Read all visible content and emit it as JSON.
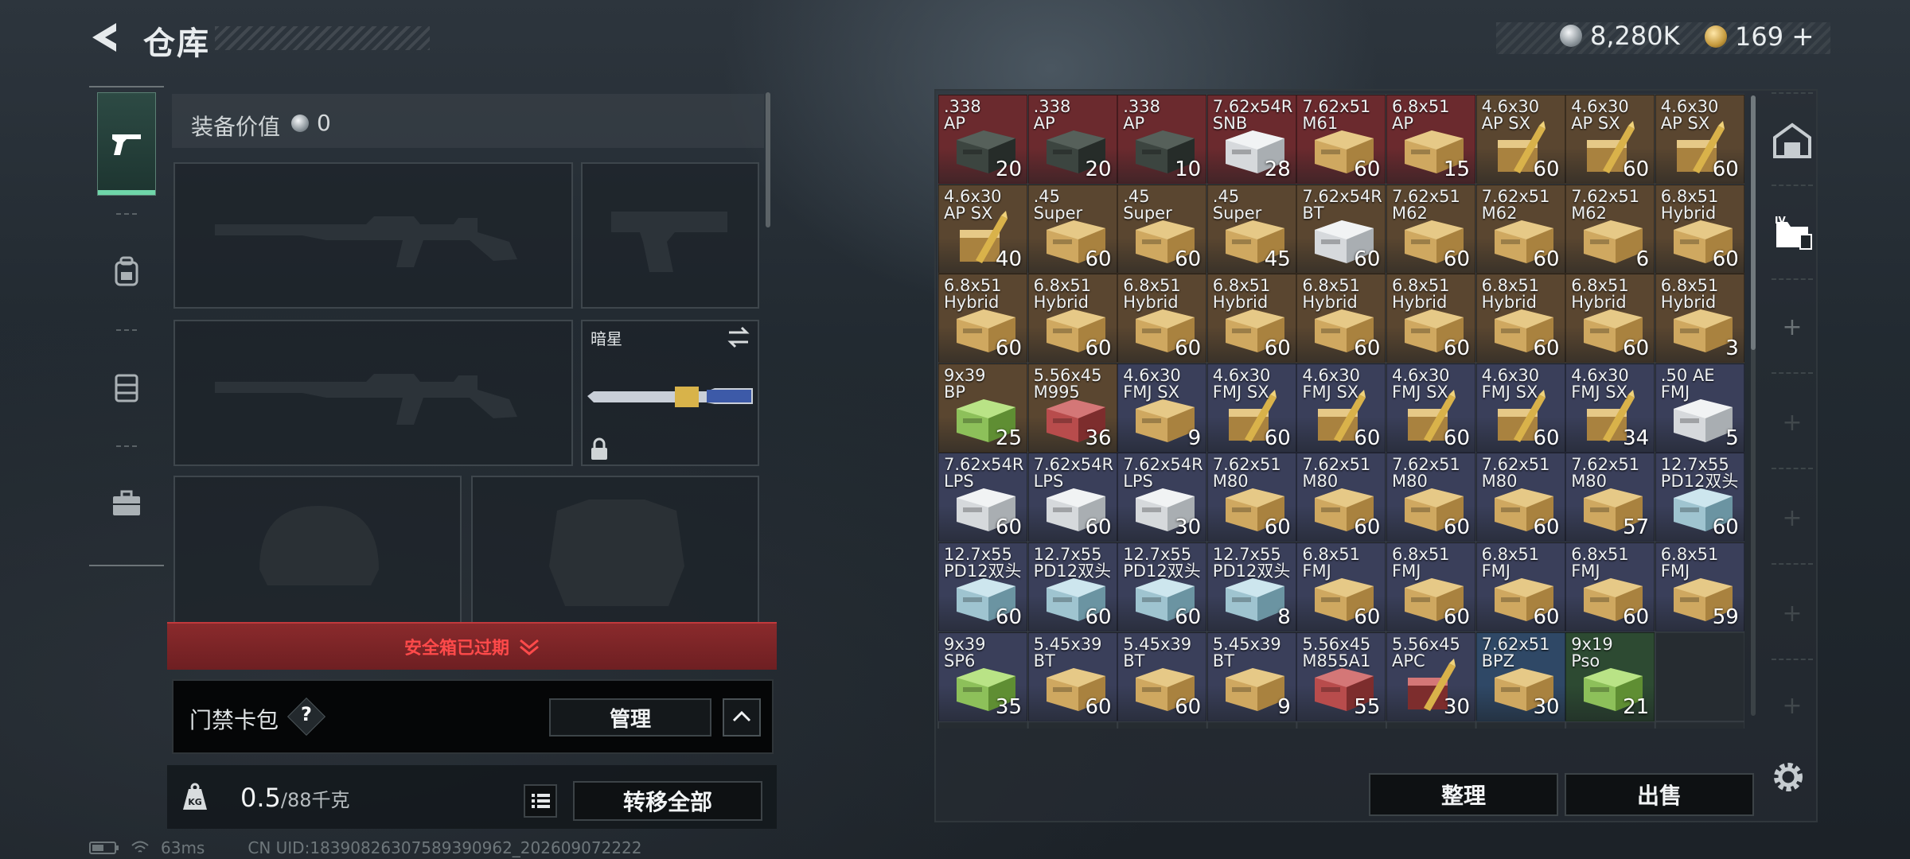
{
  "header": {
    "title": "仓库"
  },
  "currency": {
    "silver": "8,280K",
    "gold": "169",
    "gold_plus": "+"
  },
  "equipment": {
    "value_label": "装备价值",
    "value": "0",
    "melee_name": "暗星",
    "safebox_status": "安全箱已过期",
    "keycard_label": "门禁卡包",
    "help": "?",
    "manage_label": "管理",
    "weight_value": "0.5",
    "weight_capacity": "/88千克",
    "transfer_all_label": "转移全部"
  },
  "inventory": {
    "cells": [
      {
        "name": ".338\nAP",
        "count": "20",
        "bg": "#6b2a2e",
        "box": "ammo-can"
      },
      {
        "name": ".338\nAP",
        "count": "20",
        "bg": "#6b2a2e",
        "box": "ammo-can"
      },
      {
        "name": ".338\nAP",
        "count": "10",
        "bg": "#6b2a2e",
        "box": "ammo-can"
      },
      {
        "name": "7.62x54R\nSNB",
        "count": "28",
        "bg": "#6b2a2e",
        "box": "white"
      },
      {
        "name": "7.62x51\nM61",
        "count": "60",
        "bg": "#6b2a2e",
        "box": "tan"
      },
      {
        "name": "6.8x51\nAP",
        "count": "15",
        "bg": "#6b2a2e",
        "box": "tan"
      },
      {
        "name": "4.6x30\nAP SX",
        "count": "60",
        "bg": "#5a4630",
        "box": "bullet"
      },
      {
        "name": "4.6x30\nAP SX",
        "count": "60",
        "bg": "#5a4630",
        "box": "bullet"
      },
      {
        "name": "4.6x30\nAP SX",
        "count": "60",
        "bg": "#5a4630",
        "box": "bullet"
      },
      {
        "name": "4.6x30\nAP SX",
        "count": "40",
        "bg": "#5a4630",
        "box": "bullet"
      },
      {
        "name": ".45\nSuper",
        "count": "60",
        "bg": "#5a4630",
        "box": "tan"
      },
      {
        "name": ".45\nSuper",
        "count": "60",
        "bg": "#5a4630",
        "box": "tan"
      },
      {
        "name": ".45\nSuper",
        "count": "45",
        "bg": "#5a4630",
        "box": "tan"
      },
      {
        "name": "7.62x54R\nBT",
        "count": "60",
        "bg": "#5a4630",
        "box": "white"
      },
      {
        "name": "7.62x51\nM62",
        "count": "60",
        "bg": "#5a4630",
        "box": "tan"
      },
      {
        "name": "7.62x51\nM62",
        "count": "60",
        "bg": "#5a4630",
        "box": "tan"
      },
      {
        "name": "7.62x51\nM62",
        "count": "6",
        "bg": "#5a4630",
        "box": "tan"
      },
      {
        "name": "6.8x51\nHybrid",
        "count": "60",
        "bg": "#5a4630",
        "box": "tan"
      },
      {
        "name": "6.8x51\nHybrid",
        "count": "60",
        "bg": "#5a4630",
        "box": "tan"
      },
      {
        "name": "6.8x51\nHybrid",
        "count": "60",
        "bg": "#5a4630",
        "box": "tan"
      },
      {
        "name": "6.8x51\nHybrid",
        "count": "60",
        "bg": "#5a4630",
        "box": "tan"
      },
      {
        "name": "6.8x51\nHybrid",
        "count": "60",
        "bg": "#5a4630",
        "box": "tan"
      },
      {
        "name": "6.8x51\nHybrid",
        "count": "60",
        "bg": "#5a4630",
        "box": "tan"
      },
      {
        "name": "6.8x51\nHybrid",
        "count": "60",
        "bg": "#5a4630",
        "box": "tan"
      },
      {
        "name": "6.8x51\nHybrid",
        "count": "60",
        "bg": "#5a4630",
        "box": "tan"
      },
      {
        "name": "6.8x51\nHybrid",
        "count": "60",
        "bg": "#5a4630",
        "box": "tan"
      },
      {
        "name": "6.8x51\nHybrid",
        "count": "3",
        "bg": "#5a4630",
        "box": "tan"
      },
      {
        "name": "9x39\nBP",
        "count": "25",
        "bg": "#5a4630",
        "box": "green"
      },
      {
        "name": "5.56x45\nM995",
        "count": "36",
        "bg": "#5a4630",
        "box": "red"
      },
      {
        "name": "4.6x30\nFMJ SX",
        "count": "9",
        "bg": "#3a3f5a",
        "box": "tan"
      },
      {
        "name": "4.6x30\nFMJ SX",
        "count": "60",
        "bg": "#3a3f5a",
        "box": "bullet"
      },
      {
        "name": "4.6x30\nFMJ SX",
        "count": "60",
        "bg": "#3a3f5a",
        "box": "bullet"
      },
      {
        "name": "4.6x30\nFMJ SX",
        "count": "60",
        "bg": "#3a3f5a",
        "box": "bullet"
      },
      {
        "name": "4.6x30\nFMJ SX",
        "count": "60",
        "bg": "#3a3f5a",
        "box": "bullet"
      },
      {
        "name": "4.6x30\nFMJ SX",
        "count": "34",
        "bg": "#3a3f5a",
        "box": "bullet"
      },
      {
        "name": ".50 AE\nFMJ",
        "count": "5",
        "bg": "#3a3f5a",
        "box": "white"
      },
      {
        "name": "7.62x54R\nLPS",
        "count": "60",
        "bg": "#3a3f5a",
        "box": "white"
      },
      {
        "name": "7.62x54R\nLPS",
        "count": "60",
        "bg": "#3a3f5a",
        "box": "white"
      },
      {
        "name": "7.62x54R\nLPS",
        "count": "30",
        "bg": "#3a3f5a",
        "box": "white"
      },
      {
        "name": "7.62x51\nM80",
        "count": "60",
        "bg": "#3a3f5a",
        "box": "tan"
      },
      {
        "name": "7.62x51\nM80",
        "count": "60",
        "bg": "#3a3f5a",
        "box": "tan"
      },
      {
        "name": "7.62x51\nM80",
        "count": "60",
        "bg": "#3a3f5a",
        "box": "tan"
      },
      {
        "name": "7.62x51\nM80",
        "count": "60",
        "bg": "#3a3f5a",
        "box": "tan"
      },
      {
        "name": "7.62x51\nM80",
        "count": "57",
        "bg": "#3a3f5a",
        "box": "tan"
      },
      {
        "name": "12.7x55\nPD12双头",
        "count": "60",
        "bg": "#3a3f5a",
        "box": "blue"
      },
      {
        "name": "12.7x55\nPD12双头",
        "count": "60",
        "bg": "#3a3f5a",
        "box": "blue"
      },
      {
        "name": "12.7x55\nPD12双头",
        "count": "60",
        "bg": "#3a3f5a",
        "box": "blue"
      },
      {
        "name": "12.7x55\nPD12双头",
        "count": "60",
        "bg": "#3a3f5a",
        "box": "blue"
      },
      {
        "name": "12.7x55\nPD12双头",
        "count": "8",
        "bg": "#3a3f5a",
        "box": "blue"
      },
      {
        "name": "6.8x51\nFMJ",
        "count": "60",
        "bg": "#3a3f5a",
        "box": "tan"
      },
      {
        "name": "6.8x51\nFMJ",
        "count": "60",
        "bg": "#3a3f5a",
        "box": "tan"
      },
      {
        "name": "6.8x51\nFMJ",
        "count": "60",
        "bg": "#3a3f5a",
        "box": "tan"
      },
      {
        "name": "6.8x51\nFMJ",
        "count": "60",
        "bg": "#3a3f5a",
        "box": "tan"
      },
      {
        "name": "6.8x51\nFMJ",
        "count": "59",
        "bg": "#3a3f5a",
        "box": "tan"
      },
      {
        "name": "9x39\nSP6",
        "count": "35",
        "bg": "#3a3f5a",
        "box": "green"
      },
      {
        "name": "5.45x39\nBT",
        "count": "60",
        "bg": "#3a3f5a",
        "box": "tan"
      },
      {
        "name": "5.45x39\nBT",
        "count": "60",
        "bg": "#3a3f5a",
        "box": "tan"
      },
      {
        "name": "5.45x39\nBT",
        "count": "9",
        "bg": "#3a3f5a",
        "box": "tan"
      },
      {
        "name": "5.56x45\nM855A1",
        "count": "55",
        "bg": "#3a3f5a",
        "box": "red"
      },
      {
        "name": "5.56x45\nAPC",
        "count": "30",
        "bg": "#3a3f5a",
        "box": "bullet-red"
      },
      {
        "name": "7.62x51\nBPZ",
        "count": "30",
        "bg": "#2f4866",
        "box": "tan"
      },
      {
        "name": "9x19\nPso",
        "count": "21",
        "bg": "#2d4a32",
        "box": "green"
      }
    ]
  },
  "actions": {
    "tidy_label": "整理",
    "sell_label": "出售"
  },
  "status": {
    "ping": "63ms",
    "uid": "CN UID:18390826307589390962_202609072222"
  }
}
